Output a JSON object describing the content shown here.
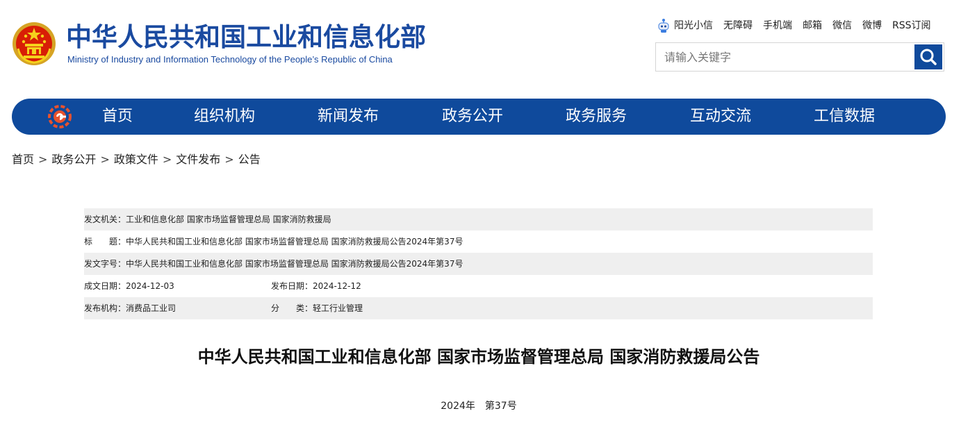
{
  "header": {
    "title": "中华人民共和国工业和信息化部",
    "subtitle": "Ministry of Industry and Information Technology of the People’s Republic of China",
    "links": [
      "阳光小信",
      "无障碍",
      "手机端",
      "邮箱",
      "微信",
      "微博",
      "RSS订阅"
    ],
    "search_placeholder": "请输入关键字"
  },
  "nav": {
    "items": [
      "首页",
      "组织机构",
      "新闻发布",
      "政务公开",
      "政务服务",
      "互动交流",
      "工信数据"
    ]
  },
  "breadcrumb": [
    "首页",
    "政务公开",
    "政策文件",
    "文件发布",
    "公告"
  ],
  "breadcrumb_separator": ">",
  "meta": {
    "issuer_label": "发文机关：",
    "issuer": "工业和信息化部 国家市场监督管理总局 国家消防救援局",
    "title_label": "标　　题：",
    "title": "中华人民共和国工业和信息化部 国家市场监督管理总局 国家消防救援局公告2024年第37号",
    "docno_label": "发文字号：",
    "docno": "中华人民共和国工业和信息化部 国家市场监督管理总局 国家消防救援局公告2024年第37号",
    "created_label": "成文日期：",
    "created": "2024-12-03",
    "published_label": "发布日期：",
    "published": "2024-12-12",
    "org_label": "发布机构：",
    "org": "消费品工业司",
    "category_label": "分　　类：",
    "category": "轻工行业管理"
  },
  "document": {
    "title": "中华人民共和国工业和信息化部 国家市场监督管理总局 国家消防救援局公告",
    "number": "2024年　第37号"
  },
  "colors": {
    "brand_blue": "#0f4a9c",
    "title_blue": "#1a4aa0",
    "shade_gray": "#efefef"
  },
  "icons": [
    "national-emblem-icon",
    "robot-icon",
    "search-icon",
    "miit-logo-icon"
  ]
}
